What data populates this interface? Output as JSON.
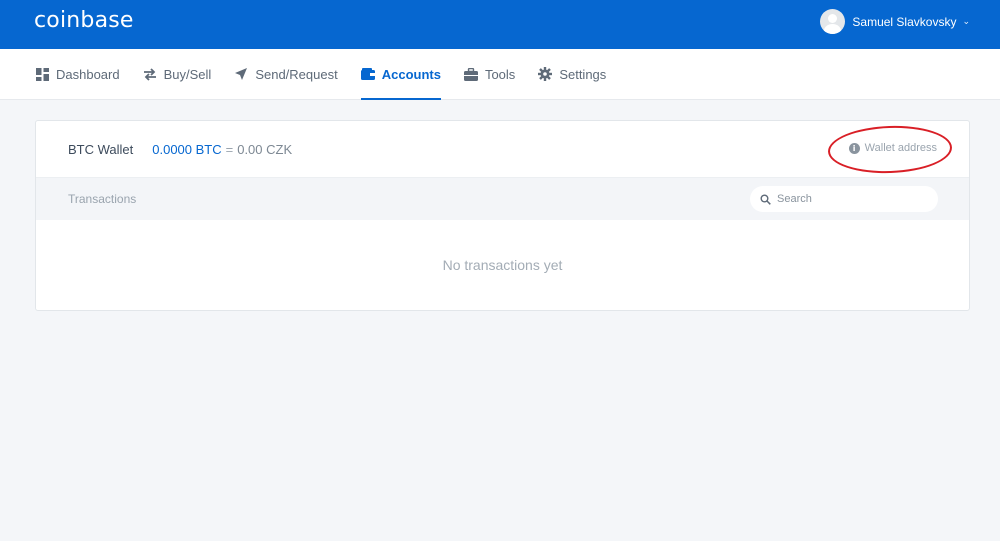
{
  "header": {
    "logo": "coinbase",
    "user_name": "Samuel Slavkovsky",
    "user_chevron": "⌄"
  },
  "nav": {
    "items": [
      {
        "label": "Dashboard",
        "icon": "dashboard-icon"
      },
      {
        "label": "Buy/Sell",
        "icon": "exchange-icon"
      },
      {
        "label": "Send/Request",
        "icon": "send-icon"
      },
      {
        "label": "Accounts",
        "icon": "wallet-icon",
        "active": true
      },
      {
        "label": "Tools",
        "icon": "briefcase-icon"
      },
      {
        "label": "Settings",
        "icon": "gear-icon"
      }
    ]
  },
  "wallet": {
    "name": "BTC Wallet",
    "btc_balance": "0.0000 BTC",
    "approx": "=",
    "fiat_balance": "0.00 CZK",
    "address_label": "Wallet address",
    "info_glyph": "i"
  },
  "transactions": {
    "label": "Transactions",
    "search_placeholder": "Search",
    "empty_message": "No transactions yet"
  },
  "colors": {
    "brand": "#0667d0",
    "annotation": "#d91f26"
  }
}
